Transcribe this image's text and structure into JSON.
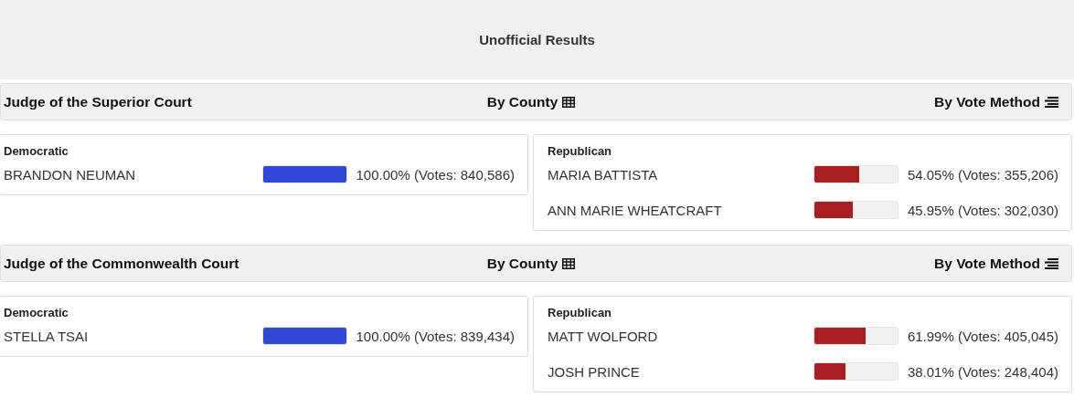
{
  "title": "Unofficial Results",
  "races": [
    {
      "name": "Judge of the Superior Court",
      "by_county": "By County",
      "by_vote_method": "By Vote Method",
      "parties": [
        {
          "party": "Democratic",
          "color": "#3149d6",
          "candidates": [
            {
              "name": "BRANDON NEUMAN",
              "level": 1.0,
              "result": "100.00% (Votes: 840,586)"
            }
          ]
        },
        {
          "party": "Republican",
          "color": "#a91e22",
          "candidates": [
            {
              "name": "MARIA BATTISTA",
              "level": 0.5405,
              "result": "54.05% (Votes: 355,206)"
            },
            {
              "name": "ANN MARIE WHEATCRAFT",
              "level": 0.4595,
              "result": "45.95% (Votes: 302,030)"
            }
          ]
        }
      ]
    },
    {
      "name": "Judge of the Commonwealth Court",
      "by_county": "By County",
      "by_vote_method": "By Vote Method",
      "parties": [
        {
          "party": "Democratic",
          "color": "#3149d6",
          "candidates": [
            {
              "name": "STELLA TSAI",
              "level": 1.0,
              "result": "100.00% (Votes: 839,434)"
            }
          ]
        },
        {
          "party": "Republican",
          "color": "#a91e22",
          "candidates": [
            {
              "name": "MATT WOLFORD",
              "level": 0.6199,
              "result": "61.99% (Votes: 405,045)"
            },
            {
              "name": "JOSH PRINCE",
              "level": 0.3801,
              "result": "38.01% (Votes: 248,404)"
            }
          ]
        }
      ]
    }
  ]
}
